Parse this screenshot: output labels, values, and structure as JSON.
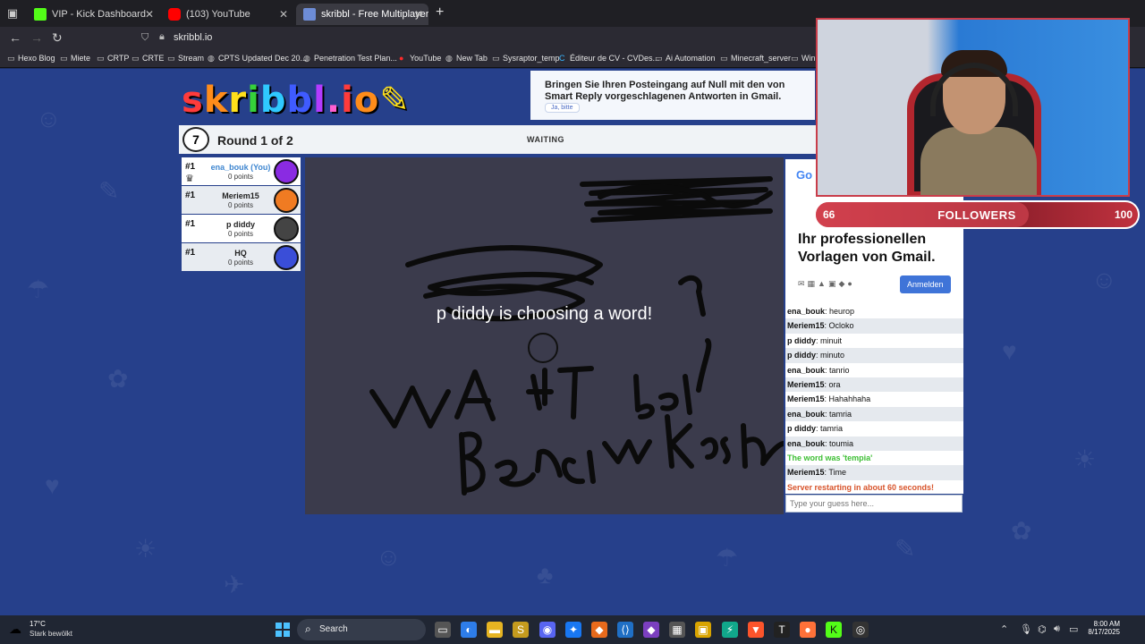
{
  "browser": {
    "tabs": [
      {
        "label": "VIP - Kick Dashboard",
        "color": "#53fc18"
      },
      {
        "label": "(103) YouTube",
        "color": "#ff0000"
      },
      {
        "label": "skribbl - Free Multiplayer Drawi",
        "color": "#6d8cd6"
      }
    ],
    "url": "skribbl.io",
    "bookmarks": [
      "Hexo Blog",
      "Miete",
      "CRTP",
      "CRTE",
      "Stream",
      "CPTS Updated Dec 20...",
      "Penetration Test Plan...",
      "YouTube",
      "New Tab",
      "Sysraptor_temp",
      "Éditeur de CV - CVDes...",
      "Ai Automation",
      "Minecraft_server",
      "Win"
    ]
  },
  "ad_top": {
    "title": "Bringen Sie Ihren Posteingang auf Null mit den von Smart Reply vorgeschlagenen Antworten in Gmail.",
    "button": "Ja, bitte"
  },
  "logo": "skribbl.io",
  "game": {
    "timer": "7",
    "round": "Round 1 of 2",
    "status": "WAITING",
    "choosing_message": "p diddy is choosing a word!"
  },
  "players": [
    {
      "rank": "#1",
      "name": "ena_bouk (You)",
      "points": "0 points",
      "color": "#8a2be2",
      "you": true
    },
    {
      "rank": "#1",
      "name": "Meriem15",
      "points": "0 points",
      "color": "#f07b22",
      "you": false
    },
    {
      "rank": "#1",
      "name": "p diddy",
      "points": "0 points",
      "color": "#444444",
      "you": false
    },
    {
      "rank": "#1",
      "name": "HQ",
      "points": "0 points",
      "color": "#3a4ed8",
      "you": false
    }
  ],
  "side_ad": {
    "brand": "Go",
    "headline": "Ihr professionellen Vorlagen von Gmail.",
    "button": "Anmelden"
  },
  "chat": [
    {
      "user": "ena_bouk",
      "text": "heurop"
    },
    {
      "user": "Meriem15",
      "text": "Ocloko"
    },
    {
      "user": "p diddy",
      "text": "minuit"
    },
    {
      "user": "p diddy",
      "text": "minuto"
    },
    {
      "user": "ena_bouk",
      "text": "tanrio"
    },
    {
      "user": "Meriem15",
      "text": "ora"
    },
    {
      "user": "Meriem15",
      "text": "Hahahhaha"
    },
    {
      "user": "ena_bouk",
      "text": "tamria"
    },
    {
      "user": "p diddy",
      "text": "tamria"
    },
    {
      "user": "ena_bouk",
      "text": "toumia"
    },
    {
      "user": "",
      "text": "The word was 'tempia'",
      "kind": "green"
    },
    {
      "user": "Meriem15",
      "text": "Time"
    },
    {
      "user": "",
      "text": "Server restarting in about 60 seconds!",
      "kind": "warn"
    }
  ],
  "guess_placeholder": "Type your guess here...",
  "followers_goal": {
    "current": "66",
    "label": "FOLLOWERS",
    "goal": "100",
    "progress": 0.66
  },
  "taskbar": {
    "temp": "17°C",
    "weather": "Stark bewölkt",
    "search": "Search",
    "time": "8:00 AM",
    "date": "8/17/2025"
  }
}
